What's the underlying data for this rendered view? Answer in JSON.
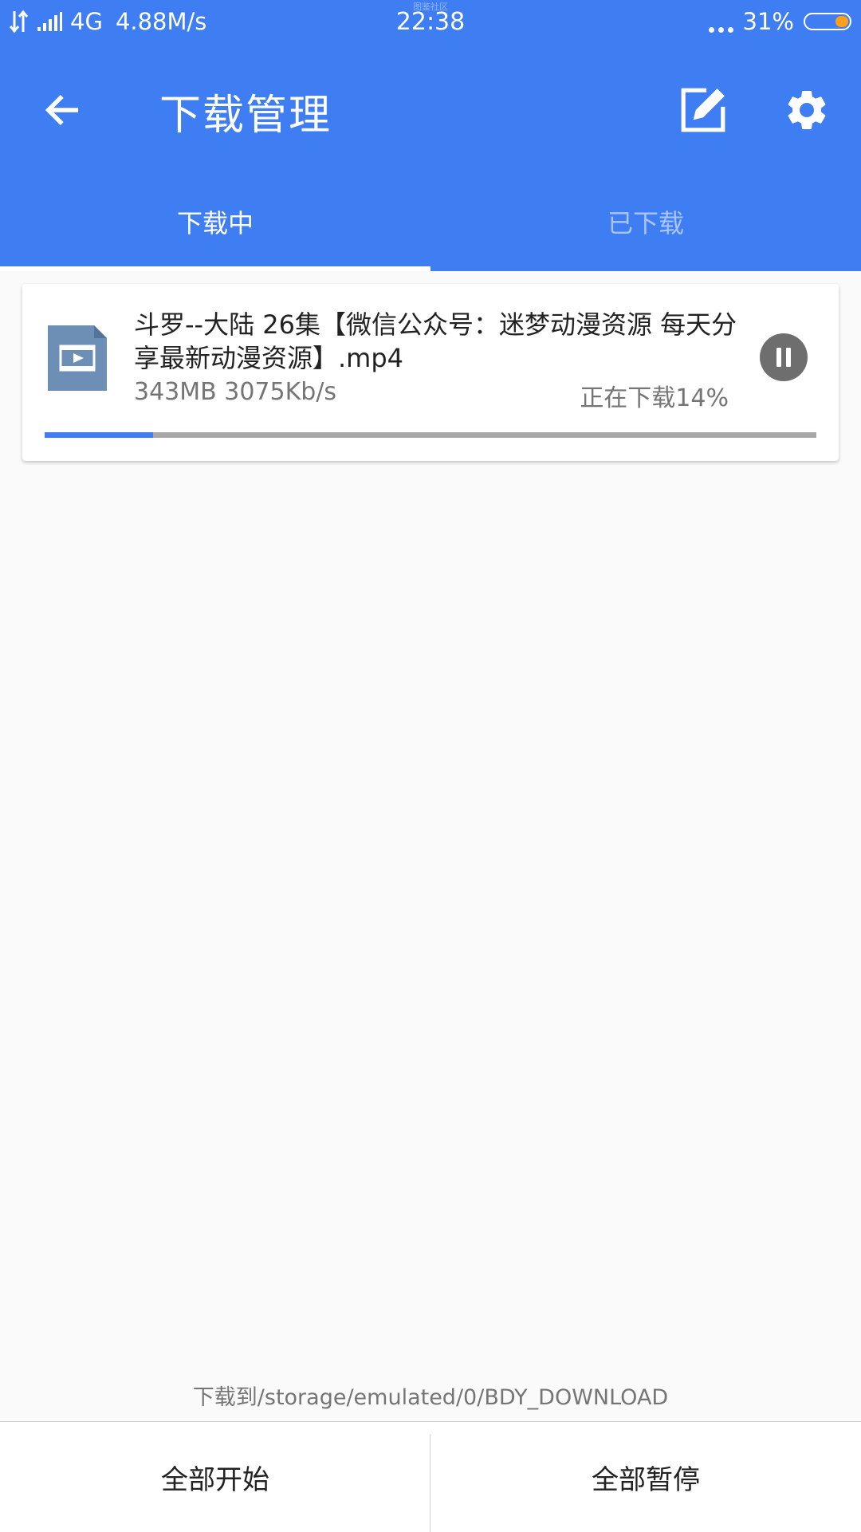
{
  "status_bar": {
    "network_type": "4G",
    "speed": "4.88M/s",
    "time": "22:38",
    "watermark": "图鉴社区",
    "battery": "31%"
  },
  "toolbar": {
    "title": "下载管理",
    "back_icon": "arrow-left-icon",
    "edit_icon": "edit-icon",
    "settings_icon": "gear-icon"
  },
  "tabs": [
    {
      "label": "下载中",
      "active": true
    },
    {
      "label": "已下载",
      "active": false
    }
  ],
  "downloads": [
    {
      "file_name": "斗罗--大陆 26集【微信公众号：迷梦动漫资源 每天分享最新动漫资源】.mp4",
      "meta": "343MB 3075Kb/s",
      "status": "正在下载14%",
      "progress": 0.14,
      "icon": "video-file-icon"
    }
  ],
  "footer": {
    "save_path": "下载到/storage/emulated/0/BDY_DOWNLOAD",
    "start_all": "全部开始",
    "pause_all": "全部暂停"
  },
  "colors": {
    "primary": "#3f7ef2",
    "tab_inactive": "#a9c5fa",
    "progress_track": "#a7a7a7",
    "battery_fill": "#ff9f1a",
    "pause_button": "#6e6e6e"
  }
}
